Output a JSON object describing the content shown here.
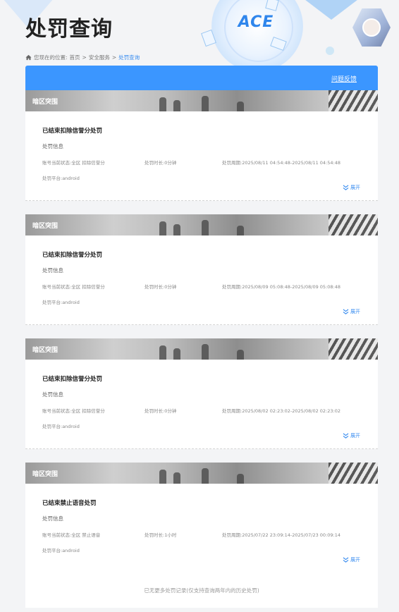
{
  "page": {
    "title": "处罚查询",
    "logo_text": "ACE"
  },
  "breadcrumb": {
    "prefix": "您现在的位置:",
    "items": [
      "首页",
      "安全服务",
      "处罚查询"
    ],
    "separator": ">"
  },
  "header": {
    "feedback_label": "问题反馈"
  },
  "records": [
    {
      "region": "暗区突围",
      "title": "已结束扣除信誉分处罚",
      "subtitle": "处罚信息",
      "status": "账号当前状态:全区 扣除信誉分",
      "duration": "处罚时长:0分钟",
      "period": "处罚周期:2025/08/11 04:54:48-2025/08/11 04:54:48",
      "platform": "处罚平台:android",
      "expand_label": "展开"
    },
    {
      "region": "暗区突围",
      "title": "已结束扣除信誉分处罚",
      "subtitle": "处罚信息",
      "status": "账号当前状态:全区 扣除信誉分",
      "duration": "处罚时长:0分钟",
      "period": "处罚周期:2025/08/09 05:08:48-2025/08/09 05:08:48",
      "platform": "处罚平台:android",
      "expand_label": "展开"
    },
    {
      "region": "暗区突围",
      "title": "已结束扣除信誉分处罚",
      "subtitle": "处罚信息",
      "status": "账号当前状态:全区 扣除信誉分",
      "duration": "处罚时长:0分钟",
      "period": "处罚周期:2025/08/02 02:23:02-2025/08/02 02:23:02",
      "platform": "处罚平台:android",
      "expand_label": "展开"
    },
    {
      "region": "暗区突围",
      "title": "已结束禁止语音处罚",
      "subtitle": "处罚信息",
      "status": "账号当前状态:全区 禁止语音",
      "duration": "处罚时长:1小时",
      "period": "处罚周期:2025/07/22 23:09:14-2025/07/23 00:09:14",
      "platform": "处罚平台:android",
      "expand_label": "展开"
    }
  ],
  "footer": {
    "note": "已无更多处罚记录(仅支持查询两年内的历史处罚)"
  },
  "colors": {
    "accent": "#3b96ff",
    "link": "#3b8ef0",
    "background": "#f3f4f6"
  },
  "icons": {
    "breadcrumb": "home-icon",
    "expand": "double-chevron-down-icon"
  }
}
